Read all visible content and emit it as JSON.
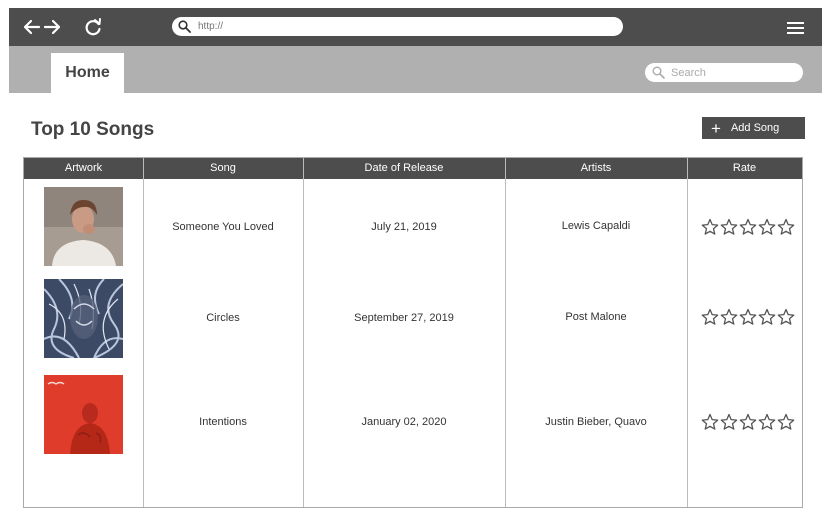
{
  "browser": {
    "url_placeholder": "http://",
    "icons": [
      "back-icon",
      "forward-icon",
      "refresh-icon",
      "search-icon",
      "hamburger-menu-icon"
    ]
  },
  "tabs": {
    "home_label": "Home",
    "search_placeholder": "Search"
  },
  "page": {
    "title": "Top 10 Songs",
    "add_button_label": "Add Song"
  },
  "table": {
    "columns": [
      "Artwork",
      "Song",
      "Date of Release",
      "Artists",
      "Rate"
    ],
    "rows": [
      {
        "artwork": "lewis-capaldi-cover",
        "song": "Someone You Loved",
        "date": "July 21, 2019",
        "artists": "Lewis Capaldi",
        "rating": 0,
        "max_rating": 5
      },
      {
        "artwork": "post-malone-cover",
        "song": "Circles",
        "date": "September 27, 2019",
        "artists": "Post Malone",
        "rating": 0,
        "max_rating": 5
      },
      {
        "artwork": "justin-bieber-cover",
        "song": "Intentions",
        "date": "January 02, 2020",
        "artists": "Justin Bieber, Quavo",
        "rating": 0,
        "max_rating": 5
      }
    ]
  },
  "colors": {
    "toolbar": "#4d4d4d",
    "tab_bar": "#b0b0b0",
    "header": "#4d4d4d"
  }
}
